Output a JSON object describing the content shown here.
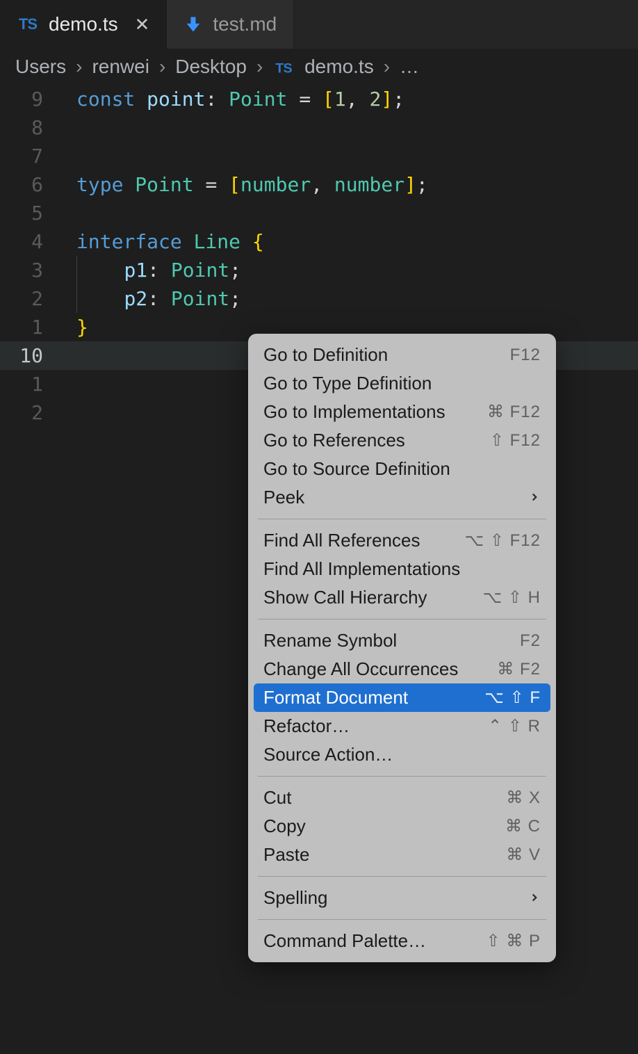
{
  "tabs": [
    {
      "icon": "ts",
      "label": "demo.ts",
      "active": true,
      "closeable": true
    },
    {
      "icon": "md",
      "label": "test.md",
      "active": false,
      "closeable": false
    }
  ],
  "breadcrumbs": {
    "segments": [
      "Users",
      "renwei",
      "Desktop"
    ],
    "file": "demo.ts",
    "symbol": "…"
  },
  "gutter": [
    "9",
    "8",
    "7",
    "6",
    "5",
    "4",
    "3",
    "2",
    "1",
    "10",
    "1",
    "2"
  ],
  "code": {
    "l0": {
      "t0": "const ",
      "t1": "point",
      "t2": ": ",
      "t3": "Point",
      "t4": " = ",
      "t5": "[",
      "t6": "1",
      "t7": ", ",
      "t8": "2",
      "t9": "]",
      "t10": ";"
    },
    "l3": {
      "t0": "type ",
      "t1": "Point",
      "t2": " = ",
      "t3": "[",
      "t4": "number",
      "t5": ", ",
      "t6": "number",
      "t7": "]",
      "t8": ";"
    },
    "l5": {
      "t0": "interface ",
      "t1": "Line",
      "t2": " ",
      "t3": "{"
    },
    "l6": {
      "pad": "    ",
      "t0": "p1",
      "t1": ": ",
      "t2": "Point",
      "t3": ";"
    },
    "l7": {
      "pad": "    ",
      "t0": "p2",
      "t1": ": ",
      "t2": "Point",
      "t3": ";"
    },
    "l8": {
      "t0": "}"
    }
  },
  "menu": {
    "groups": [
      [
        {
          "label": "Go to Definition",
          "kbd": "F12"
        },
        {
          "label": "Go to Type Definition",
          "kbd": ""
        },
        {
          "label": "Go to Implementations",
          "kbd": "⌘ F12"
        },
        {
          "label": "Go to References",
          "kbd": "⇧ F12"
        },
        {
          "label": "Go to Source Definition",
          "kbd": ""
        },
        {
          "label": "Peek",
          "kbd": "",
          "submenu": true
        }
      ],
      [
        {
          "label": "Find All References",
          "kbd": "⌥ ⇧ F12"
        },
        {
          "label": "Find All Implementations",
          "kbd": ""
        },
        {
          "label": "Show Call Hierarchy",
          "kbd": "⌥ ⇧ H"
        }
      ],
      [
        {
          "label": "Rename Symbol",
          "kbd": "F2"
        },
        {
          "label": "Change All Occurrences",
          "kbd": "⌘ F2"
        },
        {
          "label": "Format Document",
          "kbd": "⌥ ⇧ F",
          "highlight": true
        },
        {
          "label": "Refactor…",
          "kbd": "⌃ ⇧ R"
        },
        {
          "label": "Source Action…",
          "kbd": ""
        }
      ],
      [
        {
          "label": "Cut",
          "kbd": "⌘ X"
        },
        {
          "label": "Copy",
          "kbd": "⌘ C"
        },
        {
          "label": "Paste",
          "kbd": "⌘ V"
        }
      ],
      [
        {
          "label": "Spelling",
          "kbd": "",
          "submenu": true
        }
      ],
      [
        {
          "label": "Command Palette…",
          "kbd": "⇧ ⌘ P"
        }
      ]
    ]
  }
}
